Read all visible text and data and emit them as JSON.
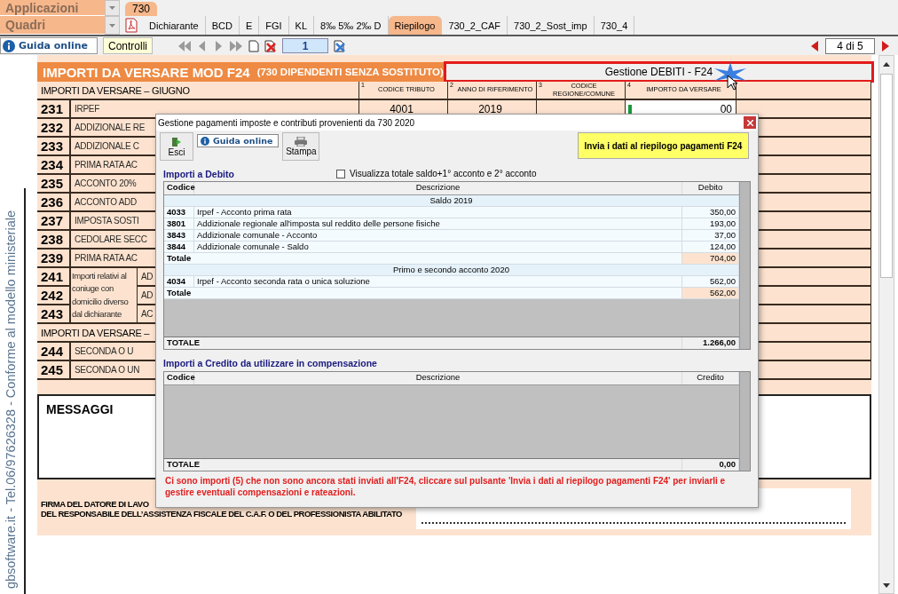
{
  "applications_bar": {
    "label": "Applicazioni",
    "tabs": [
      {
        "label": "730",
        "selected": true
      }
    ]
  },
  "sections_bar": {
    "label": "Quadri",
    "tabs": [
      {
        "label": "Dichiarante",
        "selected": false
      },
      {
        "label": "BCD",
        "selected": false
      },
      {
        "label": "E",
        "selected": false
      },
      {
        "label": "FGI",
        "selected": false
      },
      {
        "label": "KL",
        "selected": false
      },
      {
        "label": "8‰ 5‰ 2‰ D",
        "selected": false
      },
      {
        "label": "Riepilogo",
        "selected": true
      },
      {
        "label": "730_2_CAF",
        "selected": false
      },
      {
        "label": "730_2_Sost_imp",
        "selected": false
      },
      {
        "label": "730_4",
        "selected": false
      }
    ]
  },
  "toolbar": {
    "help_button": "Guida online",
    "checks_button": "Controlli",
    "page_field": "1",
    "page_indicator": "4 di 5"
  },
  "side_text": "gbsoftware.it - Tel.06/97626328 - Conforme al modello ministeriale",
  "form": {
    "title": "IMPORTI DA VERSARE MOD F24",
    "subtitle": "(730 DIPENDENTI SENZA SOSTITUTO)",
    "debts_button": "Gestione DEBITI - F24",
    "section": "IMPORTI DA VERSARE – GIUGNO",
    "columns": [
      {
        "number": "1",
        "label": "CODICE TRIBUTO"
      },
      {
        "number": "2",
        "label": "ANNO DI RIFERIMENTO"
      },
      {
        "number": "3",
        "label": "CODICE REGIONE/COMUNE"
      },
      {
        "number": "4",
        "label": "IMPORTO DA VERSARE"
      }
    ],
    "rows": [
      {
        "kind": "line",
        "number": "231",
        "label": "IRPEF",
        "code": "4001",
        "year": "2019",
        "amount": "00"
      },
      {
        "kind": "line",
        "number": "232",
        "label": "ADDIZIONALE RE"
      },
      {
        "kind": "line",
        "number": "233",
        "label": "ADDIZIONALE C"
      },
      {
        "kind": "line",
        "number": "234",
        "label": "PRIMA RATA AC"
      },
      {
        "kind": "line",
        "number": "235",
        "label": "ACCONTO 20%"
      },
      {
        "kind": "line",
        "number": "236",
        "label": "ACCONTO ADD"
      },
      {
        "kind": "line",
        "number": "237",
        "label": "IMPOSTA SOSTI"
      },
      {
        "kind": "line",
        "number": "238",
        "label": "CEDOLARE SECC"
      },
      {
        "kind": "line",
        "number": "239",
        "label": "PRIMA RATA AC"
      },
      {
        "kind": "group",
        "label": "Importi relativi al coniuge con domicilio diverso dal dichiarante",
        "items": [
          {
            "number": "241",
            "label": "AD"
          },
          {
            "number": "242",
            "label": "AD"
          },
          {
            "number": "243",
            "label": "AC"
          }
        ]
      },
      {
        "kind": "heading",
        "label": "IMPORTI DA VERSARE –"
      },
      {
        "kind": "line",
        "number": "244",
        "label": "SECONDA O U"
      },
      {
        "kind": "line",
        "number": "245",
        "label": "SECONDA O UN"
      }
    ],
    "messages_title": "MESSAGGI",
    "signature": [
      "FIRMA DEL DATORE DI LAVO",
      "DEL RESPONSABILE DELL’ASSISTENZA FISCALE DEL C.A.F. O DEL PROFESSIONISTA ABILITATO"
    ]
  },
  "dialog": {
    "title": "Gestione pagamenti imposte e contributi provenienti da 730 2020",
    "exit_button": "Esci",
    "help_button": "Guida online",
    "print_button": "Stampa",
    "send_button": "Invia i dati al riepilogo pagamenti F24",
    "debit": {
      "heading": "Importi a Debito",
      "checkbox": {
        "label": "Visualizza totale saldo+1° acconto e 2° acconto",
        "checked": false
      },
      "columns": [
        "Codice",
        "Descrizione",
        "Debito"
      ],
      "rows": [
        {
          "kind": "group",
          "label": "Saldo 2019"
        },
        {
          "kind": "item",
          "code": "4033",
          "description": "Irpef - Acconto prima rata",
          "amount": "350,00"
        },
        {
          "kind": "item",
          "code": "3801",
          "description": "Addizionale regionale all'imposta sul reddito delle persone fisiche",
          "amount": "193,00"
        },
        {
          "kind": "item",
          "code": "3843",
          "description": "Addizionale comunale - Acconto",
          "amount": "37,00"
        },
        {
          "kind": "item",
          "code": "3844",
          "description": "Addizionale comunale - Saldo",
          "amount": "124,00"
        },
        {
          "kind": "total",
          "label": "Totale",
          "amount": "704,00"
        },
        {
          "kind": "group",
          "label": "Primo e secondo acconto 2020"
        },
        {
          "kind": "item",
          "code": "4034",
          "description": "Irpef - Acconto seconda rata o unica soluzione",
          "amount": "562,00"
        },
        {
          "kind": "total",
          "label": "Totale",
          "amount": "562,00"
        }
      ],
      "total_label": "TOTALE",
      "total": "1.266,00"
    },
    "credit": {
      "heading": "Importi a Credito da utilizzare in compensazione",
      "columns": [
        "Codice",
        "Descrizione",
        "Credito"
      ],
      "total_label": "TOTALE",
      "total": "0,00"
    },
    "message": "Ci sono importi (5) che non sono ancora stati inviati all'F24, cliccare sul pulsante 'Invia i dati al riepilogo pagamenti F24' per inviarli e gestire eventuali compensazioni e rateazioni."
  }
}
